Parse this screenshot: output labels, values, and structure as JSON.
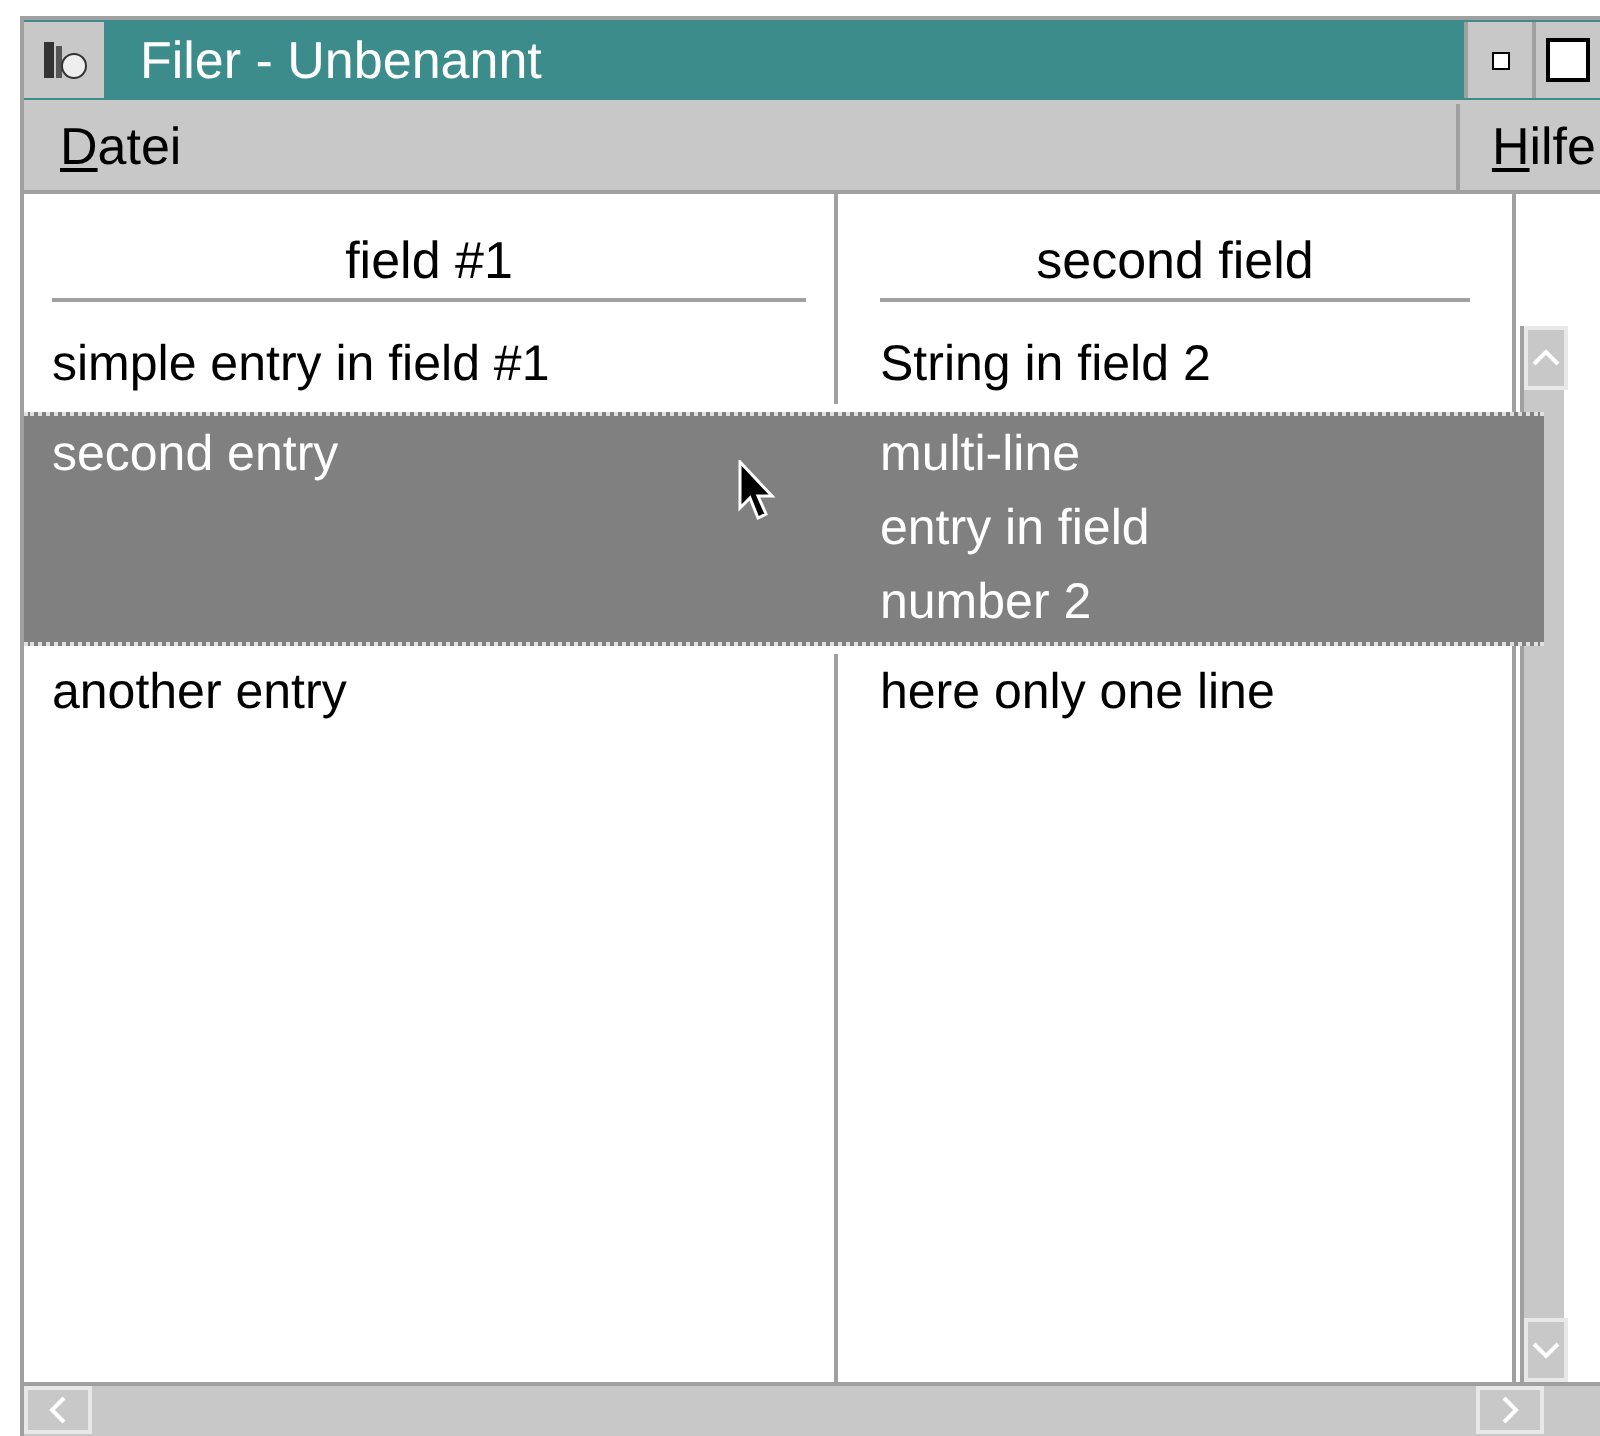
{
  "window": {
    "title": "Filer - Unbenannt"
  },
  "menu": [
    {
      "label": "Datei"
    },
    {
      "label": "Hilfe"
    }
  ],
  "table": {
    "columns": [
      "field #1",
      "second field"
    ],
    "rows": [
      {
        "cells": [
          "simple entry in field #1",
          "String in field 2"
        ],
        "selected": false
      },
      {
        "cells": [
          "second entry",
          "multi-line\nentry in field\nnumber 2"
        ],
        "selected": true
      },
      {
        "cells": [
          "another entry",
          "here only one line"
        ],
        "selected": false
      }
    ]
  }
}
